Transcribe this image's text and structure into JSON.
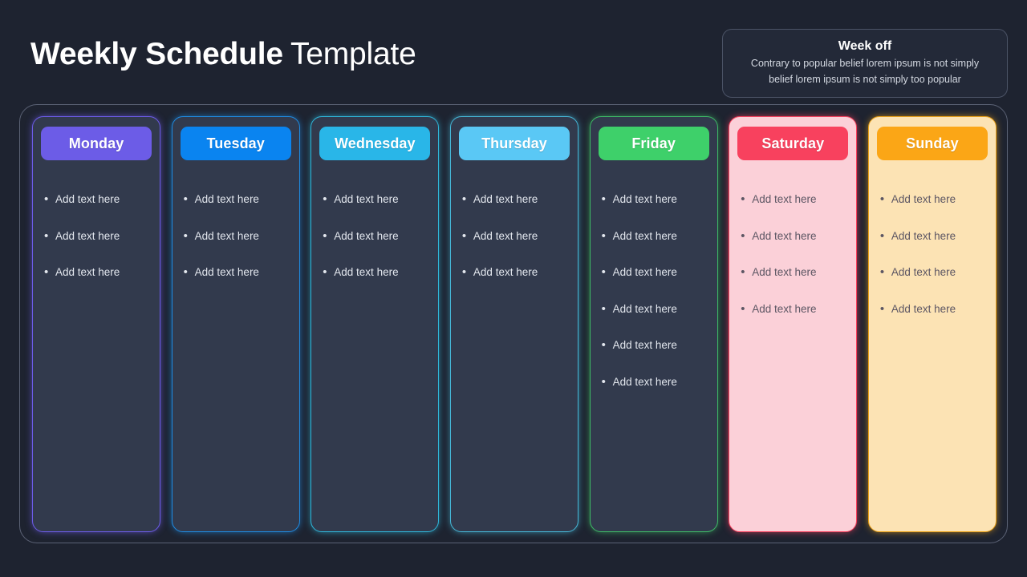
{
  "header": {
    "title_strong": "Weekly Schedule",
    "title_light": "Template"
  },
  "week_off": {
    "title": "Week off",
    "line1": "Contrary to popular belief lorem ipsum is not simply",
    "line2": "belief lorem ipsum is not simply too popular"
  },
  "bullet_glyph": "•",
  "days": [
    {
      "name": "Monday",
      "accent": "#6c5ce7",
      "theme": "dark",
      "items": [
        "Add text here",
        "Add text here",
        "Add text here"
      ]
    },
    {
      "name": "Tuesday",
      "accent": "#0a84f0",
      "theme": "dark",
      "items": [
        "Add text here",
        "Add text here",
        "Add text here"
      ]
    },
    {
      "name": "Wednesday",
      "accent": "#29b6e8",
      "theme": "dark",
      "items": [
        "Add text here",
        "Add text here",
        "Add text here"
      ]
    },
    {
      "name": "Thursday",
      "accent": "#5ac8f5",
      "theme": "dark",
      "items": [
        "Add text here",
        "Add text here",
        "Add text here"
      ]
    },
    {
      "name": "Friday",
      "accent": "#3ed06a",
      "theme": "dark",
      "items": [
        "Add text here",
        "Add text here",
        "Add text here",
        "Add text here",
        "Add text here",
        "Add text here"
      ]
    },
    {
      "name": "Saturday",
      "accent": "#f8415e",
      "theme": "light",
      "card_bg": "#fbd0d8",
      "items": [
        "Add text here",
        "Add text here",
        "Add text here",
        "Add text here"
      ]
    },
    {
      "name": "Sunday",
      "accent": "#fba616",
      "theme": "light",
      "card_bg": "#fce3b4",
      "items": [
        "Add text here",
        "Add text here",
        "Add text here",
        "Add text here"
      ]
    }
  ],
  "colors": {
    "page_background": "#1e2330",
    "card_dark": "#323a4d",
    "board_border": "#5b6275",
    "text_primary": "#ffffff",
    "text_muted_dark": "#e3e7ee",
    "text_muted_light": "#5c5663"
  }
}
